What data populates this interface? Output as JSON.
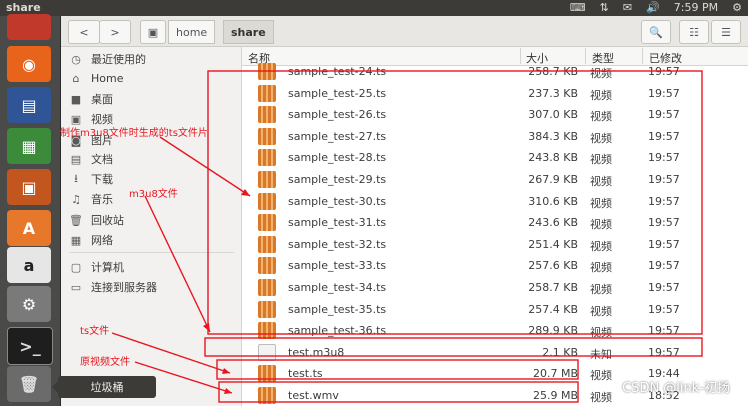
{
  "window": {
    "title": "share"
  },
  "tray": {
    "keyboard": "⌨",
    "network": "⇅",
    "mail": "✉",
    "volume": "🔊",
    "time": "7:59 PM",
    "power": "⚙"
  },
  "toolbar": {
    "back": "<",
    "forward": ">",
    "crumbs": [
      "home",
      "share"
    ],
    "search_icon": "search-icon",
    "list_icon": "list-view-icon",
    "menu_icon": "menu-icon"
  },
  "sidebar": {
    "items": [
      {
        "label": "最近使用的",
        "icon": "clock-icon",
        "glyph": "◷"
      },
      {
        "label": "Home",
        "icon": "home-icon",
        "glyph": "⌂"
      },
      {
        "label": "桌面",
        "icon": "desktop-icon",
        "glyph": "■"
      },
      {
        "label": "视频",
        "icon": "video-icon",
        "glyph": "▣"
      },
      {
        "label": "图片",
        "icon": "camera-icon",
        "glyph": "◙"
      },
      {
        "label": "文档",
        "icon": "document-icon",
        "glyph": "▤"
      },
      {
        "label": "下载",
        "icon": "download-icon",
        "glyph": "⭳"
      },
      {
        "label": "音乐",
        "icon": "music-icon",
        "glyph": "♫"
      },
      {
        "label": "回收站",
        "icon": "trash-icon",
        "glyph": "🗑"
      },
      {
        "label": "网络",
        "icon": "network-icon",
        "glyph": "▦"
      }
    ],
    "places": [
      {
        "label": "计算机",
        "icon": "computer-icon",
        "glyph": "▢"
      },
      {
        "label": "连接到服务器",
        "icon": "server-icon",
        "glyph": "▭"
      }
    ]
  },
  "columns": {
    "name": "名称",
    "size": "大小",
    "type": "类型",
    "modified": "已修改"
  },
  "files": [
    {
      "name": "sample_test-24.ts",
      "size": "258.7 KB",
      "type": "视频",
      "modified": "19:57",
      "kind": "video"
    },
    {
      "name": "sample_test-25.ts",
      "size": "237.3 KB",
      "type": "视频",
      "modified": "19:57",
      "kind": "video"
    },
    {
      "name": "sample_test-26.ts",
      "size": "307.0 KB",
      "type": "视频",
      "modified": "19:57",
      "kind": "video"
    },
    {
      "name": "sample_test-27.ts",
      "size": "384.3 KB",
      "type": "视频",
      "modified": "19:57",
      "kind": "video"
    },
    {
      "name": "sample_test-28.ts",
      "size": "243.8 KB",
      "type": "视频",
      "modified": "19:57",
      "kind": "video"
    },
    {
      "name": "sample_test-29.ts",
      "size": "267.9 KB",
      "type": "视频",
      "modified": "19:57",
      "kind": "video"
    },
    {
      "name": "sample_test-30.ts",
      "size": "310.6 KB",
      "type": "视频",
      "modified": "19:57",
      "kind": "video"
    },
    {
      "name": "sample_test-31.ts",
      "size": "243.6 KB",
      "type": "视频",
      "modified": "19:57",
      "kind": "video"
    },
    {
      "name": "sample_test-32.ts",
      "size": "251.4 KB",
      "type": "视频",
      "modified": "19:57",
      "kind": "video"
    },
    {
      "name": "sample_test-33.ts",
      "size": "257.6 KB",
      "type": "视频",
      "modified": "19:57",
      "kind": "video"
    },
    {
      "name": "sample_test-34.ts",
      "size": "258.7 KB",
      "type": "视频",
      "modified": "19:57",
      "kind": "video"
    },
    {
      "name": "sample_test-35.ts",
      "size": "257.4 KB",
      "type": "视频",
      "modified": "19:57",
      "kind": "video"
    },
    {
      "name": "sample_test-36.ts",
      "size": "289.9 KB",
      "type": "视频",
      "modified": "19:57",
      "kind": "video"
    },
    {
      "name": "test.m3u8",
      "size": "2.1 KB",
      "type": "未知",
      "modified": "19:57",
      "kind": "text"
    },
    {
      "name": "test.ts",
      "size": "20.7 MB",
      "type": "视频",
      "modified": "19:44",
      "kind": "video"
    },
    {
      "name": "test.wmv",
      "size": "25.9 MB",
      "type": "视频",
      "modified": "18:52",
      "kind": "video"
    }
  ],
  "annotations": {
    "ts_segments": "制作m3u8文件时生成的ts文件片",
    "m3u8": "m3u8文件",
    "ts_file": "ts文件",
    "source_video": "原视频文件",
    "color": "#e8161f"
  },
  "launcher_tooltip": "垃圾桶",
  "watermark": "CSDN @link-初扬"
}
